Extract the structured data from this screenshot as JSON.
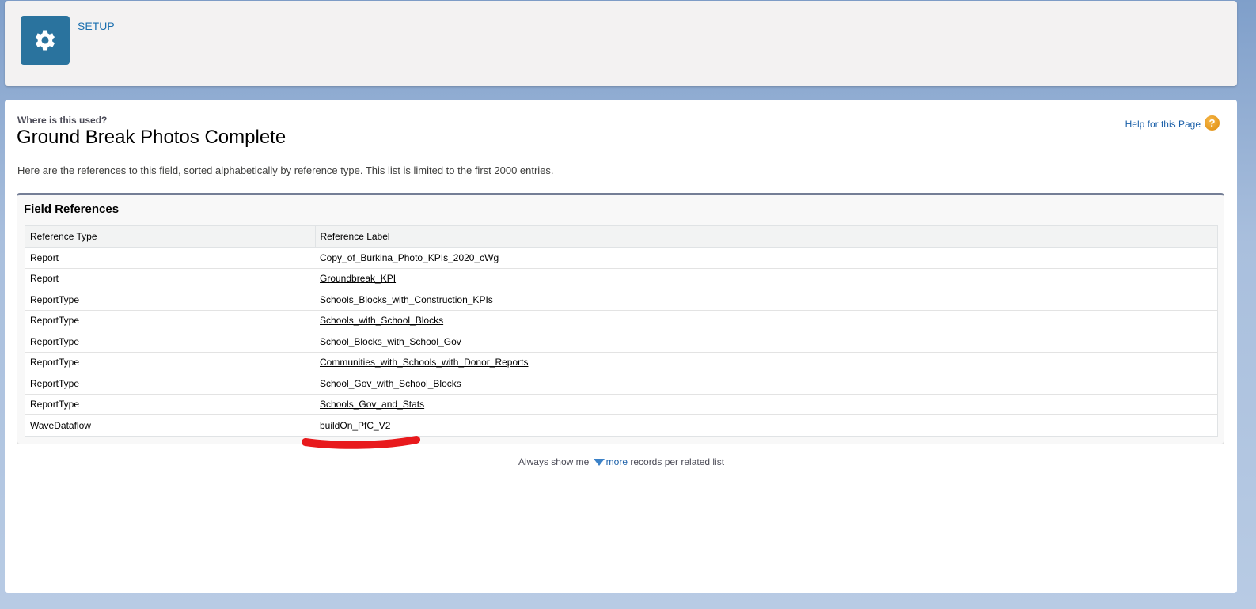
{
  "header": {
    "app_label": "SETUP",
    "icon": "gear-icon"
  },
  "page": {
    "subtitle": "Where is this used?",
    "title": "Ground Break Photos Complete",
    "help_link": "Help for this Page",
    "description": "Here are the references to this field, sorted alphabetically by reference type. This list is limited to the first 2000 entries."
  },
  "panel": {
    "title": "Field References",
    "columns": [
      "Reference Type",
      "Reference Label"
    ],
    "rows": [
      {
        "type": "Report",
        "label": "Copy_of_Burkina_Photo_KPIs_2020_cWg",
        "link": false
      },
      {
        "type": "Report",
        "label": "Groundbreak_KPI",
        "link": true
      },
      {
        "type": "ReportType",
        "label": "Schools_Blocks_with_Construction_KPIs",
        "link": true
      },
      {
        "type": "ReportType",
        "label": "Schools_with_School_Blocks",
        "link": true
      },
      {
        "type": "ReportType",
        "label": "School_Blocks_with_School_Gov",
        "link": true
      },
      {
        "type": "ReportType",
        "label": "Communities_with_Schools_with_Donor_Reports",
        "link": true
      },
      {
        "type": "ReportType",
        "label": "School_Gov_with_School_Blocks",
        "link": true
      },
      {
        "type": "ReportType",
        "label": "Schools_Gov_and_Stats",
        "link": true
      },
      {
        "type": "WaveDataflow",
        "label": "buildOn_PfC_V2",
        "link": false
      }
    ]
  },
  "footer": {
    "prefix": "Always show me",
    "link": "more",
    "suffix": "records per related list"
  },
  "colors": {
    "accent": "#2a739e",
    "annotation": "#e8191c"
  }
}
